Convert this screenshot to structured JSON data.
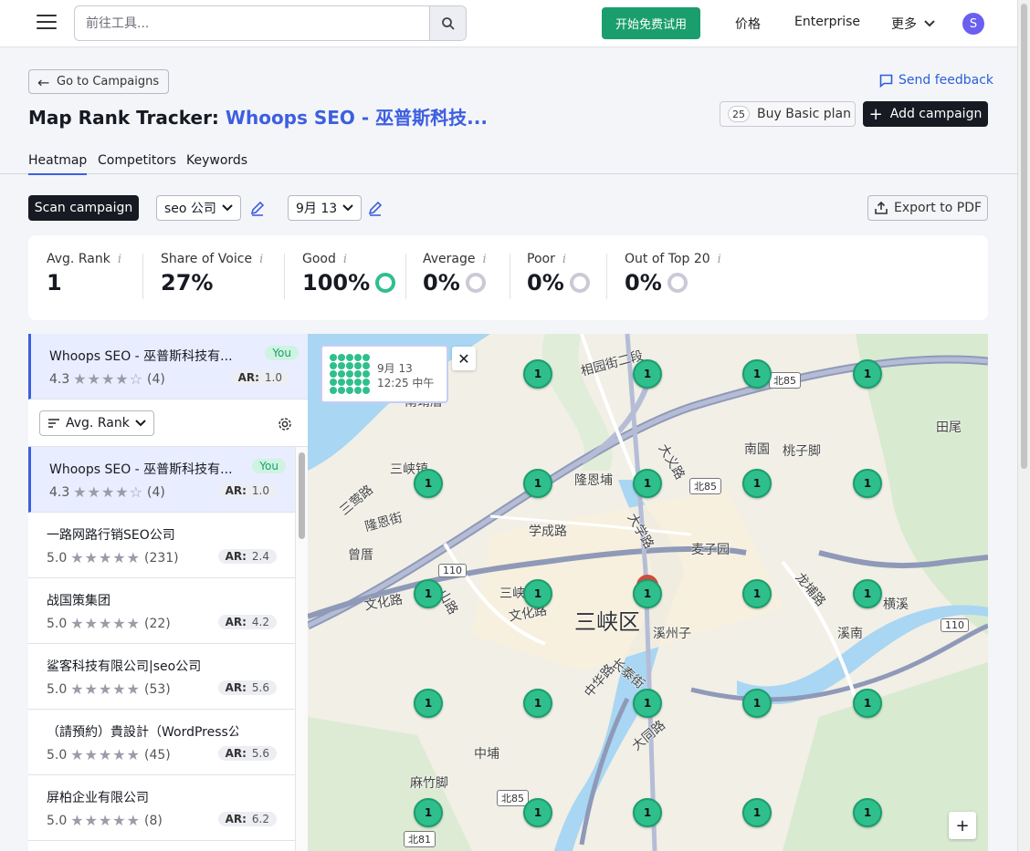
{
  "nav": {
    "search_placeholder": "前往工具...",
    "trial_label": "开始免费试用",
    "pricing_label": "价格",
    "enterprise_label": "Enterprise",
    "more_label": "更多",
    "avatar_initial": "S"
  },
  "header": {
    "back_label": "Go to Campaigns",
    "feedback_label": "Send feedback",
    "title_prefix": "Map Rank Tracker:",
    "project_name": "Whoops SEO - 巫普斯科技...",
    "buy_count": "25",
    "buy_label": "Buy Basic plan",
    "add_label": "Add campaign"
  },
  "tabs": [
    "Heatmap",
    "Competitors",
    "Keywords"
  ],
  "controls": {
    "scan_label": "Scan campaign",
    "keyword": "seo 公司",
    "date": "9月 13",
    "export_label": "Export to PDF"
  },
  "stats": [
    {
      "label": "Avg. Rank",
      "value": "1",
      "ring": "none"
    },
    {
      "label": "Share of Voice",
      "value": "27%",
      "ring": "none"
    },
    {
      "label": "Good",
      "value": "100%",
      "ring": "green"
    },
    {
      "label": "Average",
      "value": "0%",
      "ring": "gray"
    },
    {
      "label": "Poor",
      "value": "0%",
      "ring": "gray"
    },
    {
      "label": "Out of Top 20",
      "value": "0%",
      "ring": "gray"
    }
  ],
  "pinned": {
    "name": "Whoops SEO - 巫普斯科技有...",
    "badge": "You",
    "rating": "4.3",
    "reviews": "(4)",
    "ar_label": "AR:",
    "ar": "1.0"
  },
  "sort": {
    "label": "Avg. Rank"
  },
  "businesses": [
    {
      "name": "Whoops SEO - 巫普斯科技有...",
      "badge": "You",
      "rating": "4.3",
      "reviews": "(4)",
      "ar": "1.0",
      "stars": 4
    },
    {
      "name": "一路网路行销SEO公司",
      "badge": "",
      "rating": "5.0",
      "reviews": "(231)",
      "ar": "2.4",
      "stars": 5
    },
    {
      "name": "战国策集团",
      "badge": "",
      "rating": "5.0",
      "reviews": "(22)",
      "ar": "4.2",
      "stars": 5
    },
    {
      "name": "鲨客科技有限公司|seo公司",
      "badge": "",
      "rating": "5.0",
      "reviews": "(53)",
      "ar": "5.6",
      "stars": 5
    },
    {
      "name": "（請預約）貴設計（WordPress公司...",
      "badge": "",
      "rating": "5.0",
      "reviews": "(45)",
      "ar": "5.6",
      "stars": 5
    },
    {
      "name": "屏柏企业有限公司",
      "badge": "",
      "rating": "5.0",
      "reviews": "(8)",
      "ar": "6.2",
      "stars": 5
    }
  ],
  "map": {
    "popup_date": "9月 13",
    "popup_time": "12:25 中午",
    "pin_rank": "1",
    "labels": [
      "相园街二段",
      "南園",
      "桃子脚",
      "田尾",
      "三峡镇",
      "隆恩埔",
      "大义路",
      "三莺路",
      "学成路",
      "大学路",
      "隆恩街",
      "麦子园",
      "曾厝",
      "龙埔路",
      "横溪",
      "三峡区",
      "文化路",
      "溪州子",
      "溪南",
      "中华路",
      "长泰街",
      "大同路",
      "中埔",
      "麻竹脚",
      "三峡",
      "山路",
      "文化路",
      "南靖厝"
    ],
    "shields": [
      "北85",
      "北85",
      "110",
      "110",
      "北85",
      "北81"
    ],
    "zoom_plus": "+"
  }
}
